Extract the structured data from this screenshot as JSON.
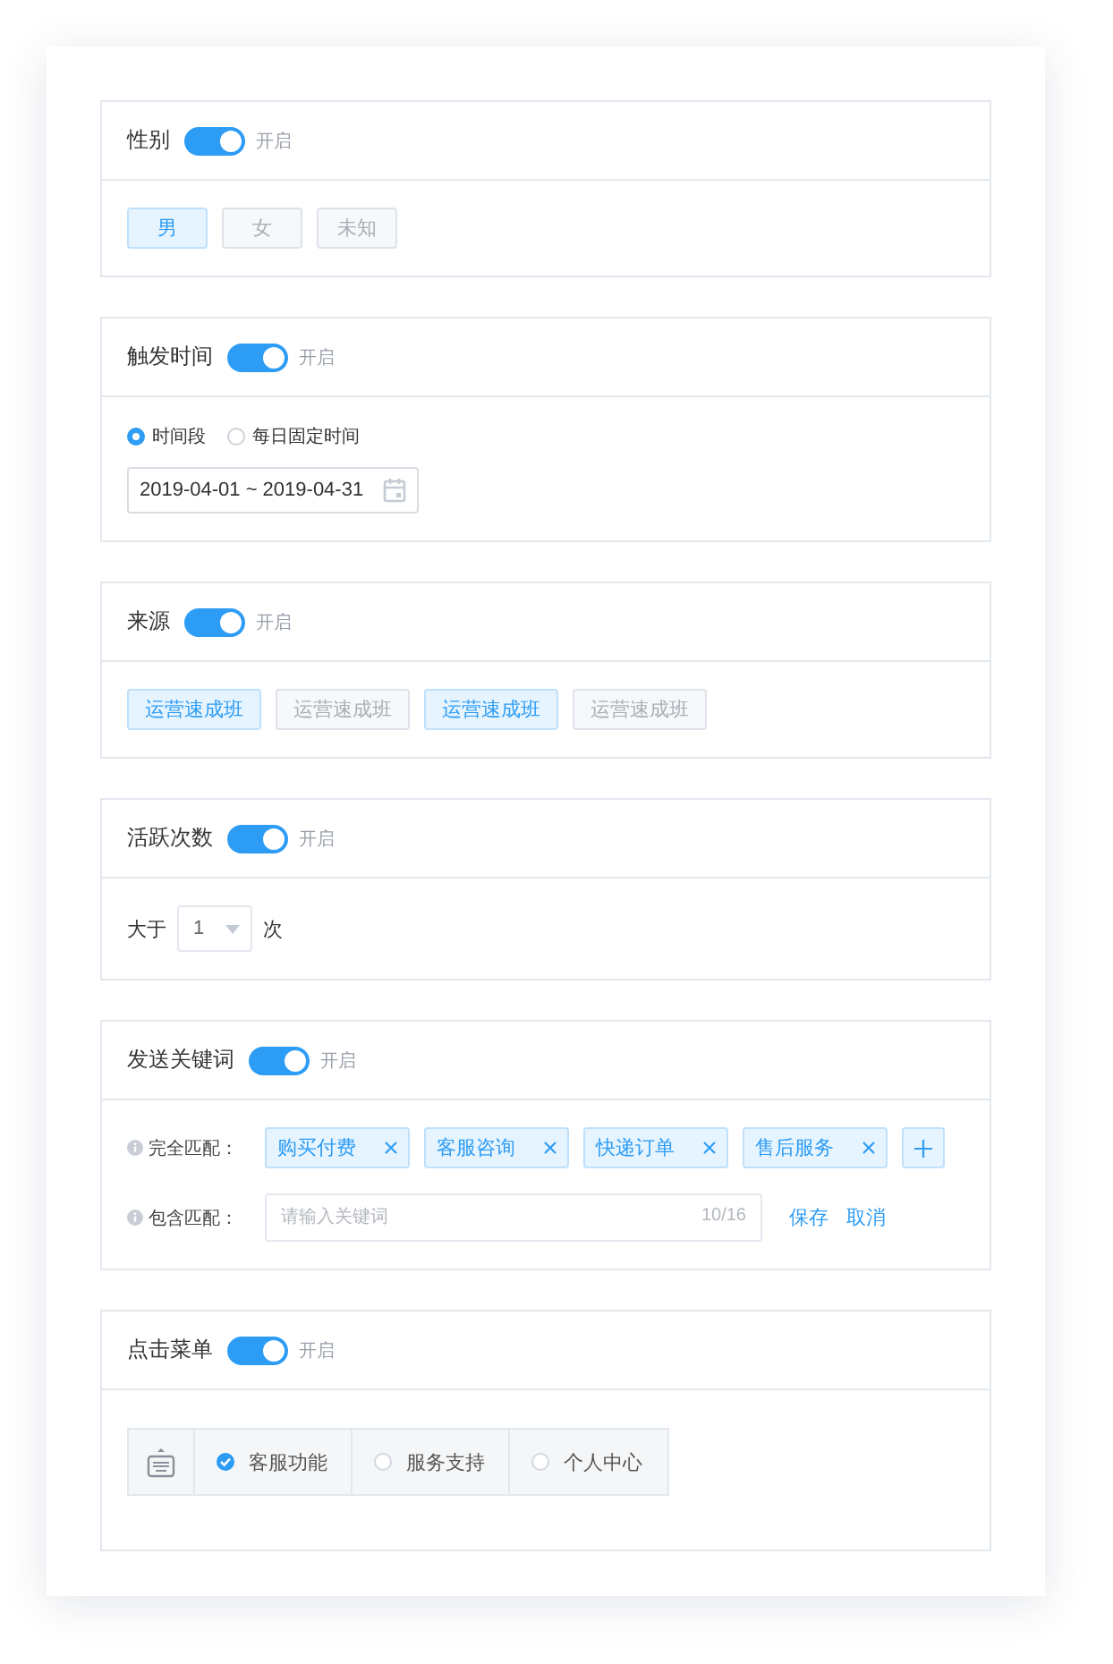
{
  "sections": [
    {
      "kind": "options",
      "title": "性别",
      "toggle": {
        "on": true,
        "label": "开启"
      },
      "options": [
        {
          "label": "男",
          "selected": true
        },
        {
          "label": "女",
          "selected": false
        },
        {
          "label": "未知",
          "selected": false
        }
      ]
    },
    {
      "kind": "time",
      "title": "触发时间",
      "toggle": {
        "on": true,
        "label": "开启"
      },
      "radios": [
        {
          "label": "时间段",
          "selected": true
        },
        {
          "label": "每日固定时间",
          "selected": false
        }
      ],
      "date_range": "2019-04-01 ~ 2019-04-31"
    },
    {
      "kind": "options",
      "title": "来源",
      "toggle": {
        "on": true,
        "label": "开启"
      },
      "options": [
        {
          "label": "运营速成班",
          "selected": true
        },
        {
          "label": "运营速成班",
          "selected": false
        },
        {
          "label": "运营速成班",
          "selected": true
        },
        {
          "label": "运营速成班",
          "selected": false
        }
      ]
    },
    {
      "kind": "count",
      "title": "活跃次数",
      "toggle": {
        "on": true,
        "label": "开启"
      },
      "prefix": "大于",
      "select_value": "1",
      "suffix": "次"
    },
    {
      "kind": "keywords",
      "title": "发送关键词",
      "toggle": {
        "on": true,
        "label": "开启"
      },
      "exact_label": "完全匹配：",
      "tags": [
        "购买付费",
        "客服咨询",
        "快递订单",
        "售后服务"
      ],
      "contains_label": "包含匹配：",
      "input": {
        "placeholder": "请输入关键词",
        "counter": "10/16"
      },
      "actions": [
        "保存",
        "取消"
      ]
    },
    {
      "kind": "menu",
      "title": "点击菜单",
      "toggle": {
        "on": true,
        "label": "开启"
      },
      "items": [
        {
          "label": "客服功能",
          "selected": true
        },
        {
          "label": "服务支持",
          "selected": false
        },
        {
          "label": "个人中心",
          "selected": false
        }
      ]
    }
  ]
}
